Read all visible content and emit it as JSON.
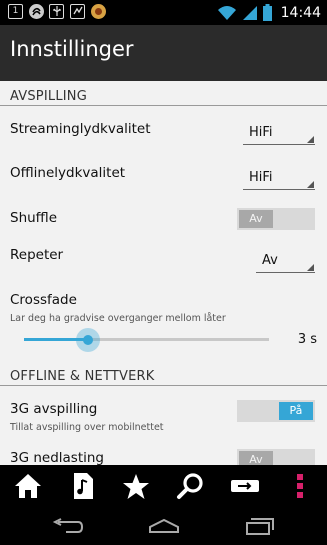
{
  "status_bar": {
    "time": "14:44",
    "left_icons": [
      "notification-1-icon",
      "sync-icon",
      "usb-icon",
      "app-icon"
    ],
    "notif_badge": "1",
    "right_icons": [
      "wifi-icon",
      "signal-icon",
      "battery-icon"
    ]
  },
  "action_bar": {
    "title": "Innstillinger"
  },
  "sections": {
    "playback": {
      "header": "AVSPILLING"
    },
    "offline": {
      "header": "OFFLINE & NETTVERK"
    }
  },
  "prefs": {
    "streaming_quality": {
      "title": "Streaminglydkvalitet",
      "value": "HiFi"
    },
    "offline_quality": {
      "title": "Offlinelydkvalitet",
      "value": "HiFi"
    },
    "shuffle": {
      "title": "Shuffle",
      "state": "Av"
    },
    "repeat": {
      "title": "Repeter",
      "value": "Av"
    },
    "crossfade": {
      "title": "Crossfade",
      "subtitle": "Lar deg ha gradvise overganger mellom låter",
      "value_label": "3 s",
      "fraction": 0.26
    },
    "play_3g": {
      "title": "3G avspilling",
      "subtitle": "Tillat avspilling over mobilnettet",
      "state": "På"
    },
    "download_3g": {
      "title": "3G nedlasting",
      "state": "Av"
    }
  },
  "toolbar": {
    "items": [
      "home-icon",
      "music-note-icon",
      "star-icon",
      "search-icon",
      "now-playing-icon",
      "overflow-menu-icon"
    ]
  },
  "navbar": {
    "items": [
      "back-icon",
      "home-nav-icon",
      "recents-icon"
    ]
  },
  "colors": {
    "accent": "#35a6d6",
    "overflow": "#d6206a",
    "background": "#f2f2f2"
  }
}
